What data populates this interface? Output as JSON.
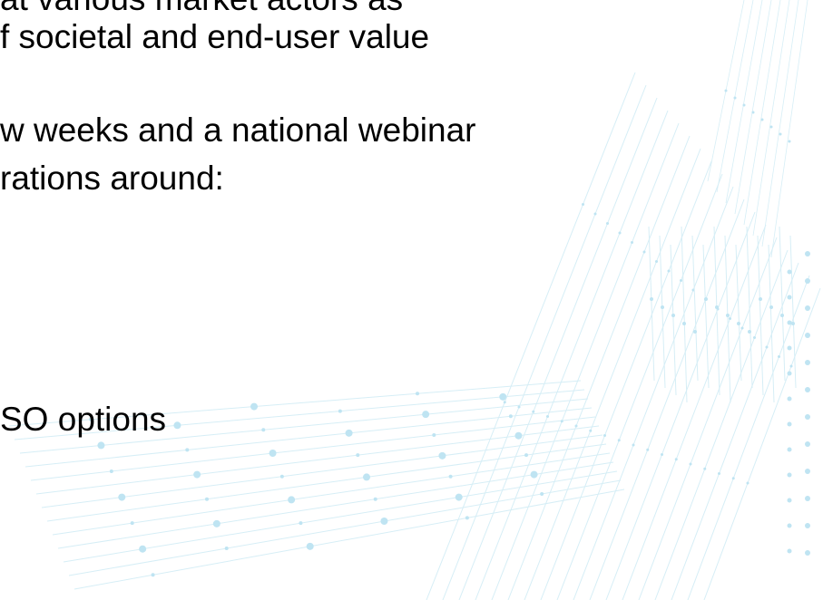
{
  "slide": {
    "lines": [
      "at various market actors as",
      "f societal and end-user value",
      "w weeks and a national webinar",
      "rations around:",
      "SO options"
    ]
  },
  "background": {
    "motif": "network-dots-lines-decoration",
    "line_color": "#d6eef6",
    "dot_color": "#bfe4f2"
  }
}
